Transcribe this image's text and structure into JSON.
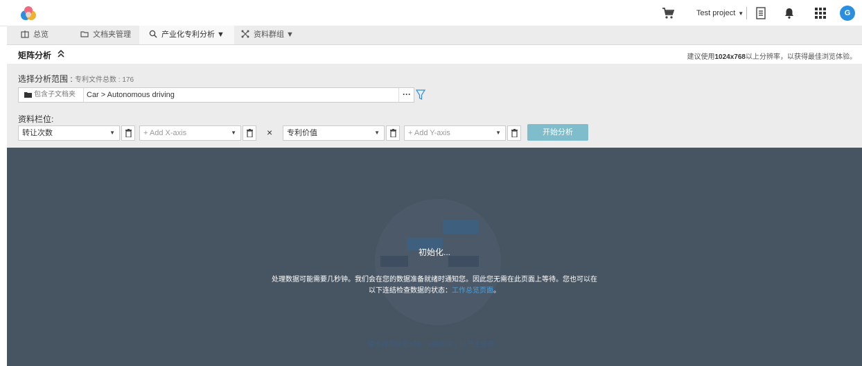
{
  "header": {
    "project_name": "Test project",
    "avatar_initial": "G"
  },
  "nav": {
    "tabs": [
      {
        "label": "总览",
        "icon": "building-icon"
      },
      {
        "label": "文档夹管理",
        "icon": "folder-icon"
      },
      {
        "label": "产业化专利分析 ▼",
        "icon": "magnify-icon"
      },
      {
        "label": "资料群组 ▼",
        "icon": "cluster-icon"
      }
    ],
    "active_index": 2
  },
  "section": {
    "title": "矩阵分析",
    "hint_prefix": "建议使用",
    "hint_resolution": "1024x768",
    "hint_suffix": "以上分辨率，以获得最佳浏览体验。"
  },
  "scope": {
    "label": "选择分析范围 :",
    "count_text": "专利文件总数 : 176",
    "folder_button": "包含子文档夹",
    "path": "Car > Autonomous driving",
    "more": "···"
  },
  "fields": {
    "label": "资料栏位:",
    "x1": "转让次数",
    "x2_placeholder": "+ Add X-axis",
    "times": "×",
    "y1": "专利价值",
    "y2_placeholder": "+ Add Y-axis",
    "start_button": "开始分析"
  },
  "result": {
    "status": "初始化...",
    "message_line1": "处理数据可能需要几秒钟。我们会在您的数据准备就绪时通知您。因此您无需在此页面上等待。您也可以在",
    "message_line2_prefix": "以下连结检查数据的状态：",
    "message_link": "工作总览页面",
    "message_line2_suffix": "。",
    "hint": "请选择及设定X轴、Y轴条件，以产生报表。"
  },
  "colors": {
    "accent": "#2b8fe0",
    "start_button": "#7fbccc",
    "result_bg": "#475563",
    "link": "#4aa3df"
  }
}
